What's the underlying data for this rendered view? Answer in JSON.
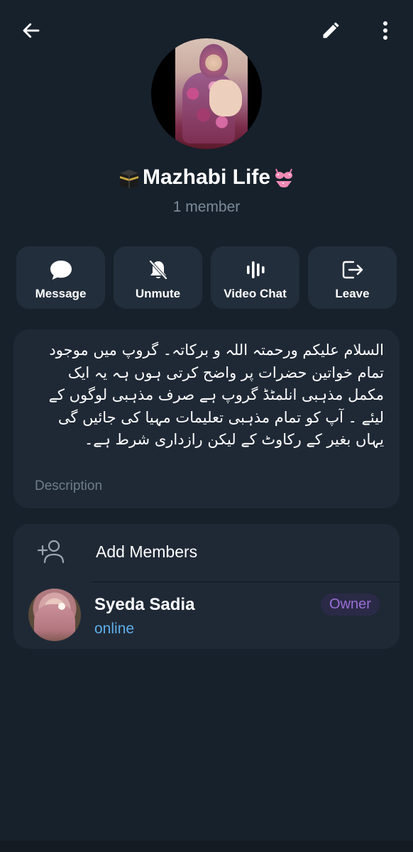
{
  "header": {
    "back_icon": "arrow-left-icon",
    "edit_icon": "pencil-icon",
    "more_icon": "more-vertical-icon"
  },
  "group": {
    "title": "Mazhabi Life",
    "title_prefix_emoji": "kaaba",
    "title_suffix_emoji": "bikini",
    "member_count": "1 member"
  },
  "actions": [
    {
      "label": "Message",
      "icon": "message-bubble-icon"
    },
    {
      "label": "Unmute",
      "icon": "bell-off-icon"
    },
    {
      "label": "Video Chat",
      "icon": "voice-bars-icon"
    },
    {
      "label": "Leave",
      "icon": "logout-icon"
    }
  ],
  "description": {
    "text": "السلام علیکم ورحمتہ اللہ و برکاتہ۔ گروپ میں موجود تمام خواتین حضرات پر واضح کرتی ہوں ہہ یہ ایک مکمل مذہبی انلمٹڈ گروپ ہے صرف مذہبی لوگوں کے لیئے ۔ آپ کو تمام مذہبی تعلیمات مہیا کی جائیں گی یہاں بغیر کے رکاوٹ کے لیکن رازداری شرط ہے۔",
    "label": "Description"
  },
  "members": {
    "add_label": "Add Members",
    "add_icon": "add-person-icon",
    "list": [
      {
        "name": "Syeda Sadia",
        "status": "online",
        "role": "Owner"
      }
    ]
  },
  "colors": {
    "background": "#17212b",
    "card": "#1f2936",
    "button": "#232e3c",
    "accent_online": "#5eaee8",
    "owner_badge": "#9a6fd6"
  }
}
